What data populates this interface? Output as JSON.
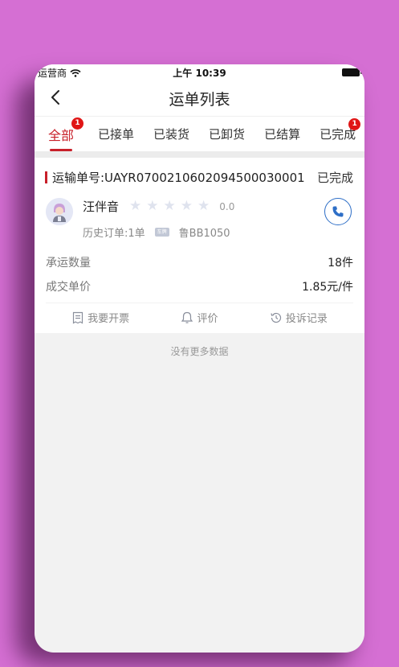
{
  "status_bar": {
    "carrier": "运营商",
    "time": "上午 10:39"
  },
  "nav": {
    "title": "运单列表"
  },
  "tabs": [
    {
      "label": "全部",
      "badge": "1",
      "active": true
    },
    {
      "label": "已接单"
    },
    {
      "label": "已装货"
    },
    {
      "label": "已卸货"
    },
    {
      "label": "已结算"
    },
    {
      "label": "已完成",
      "badge": "1"
    }
  ],
  "order": {
    "number_label": "运输单号:UAYR070021060209450003000​1",
    "status": "已完成",
    "driver": {
      "name": "汪伴音",
      "rating": "0.0",
      "stars_filled": 0,
      "stars_total": 5,
      "history_orders": "历史订单:1单",
      "plate_icon_text": "车牌",
      "plate": "鲁BB1050"
    },
    "details": [
      {
        "label": "承运数量",
        "value": "18件"
      },
      {
        "label": "成交单价",
        "value": "1.85元/件"
      }
    ],
    "actions": [
      {
        "label": "我要开票",
        "icon": "invoice-icon"
      },
      {
        "label": "评价",
        "icon": "review-icon"
      },
      {
        "label": "投诉记录",
        "icon": "history-icon"
      }
    ]
  },
  "footer": {
    "no_more": "没有更多数据"
  },
  "colors": {
    "accent": "#c8202a",
    "badge": "#e01616",
    "phone_blue": "#2e6fc7",
    "background": "#d56fd3"
  }
}
